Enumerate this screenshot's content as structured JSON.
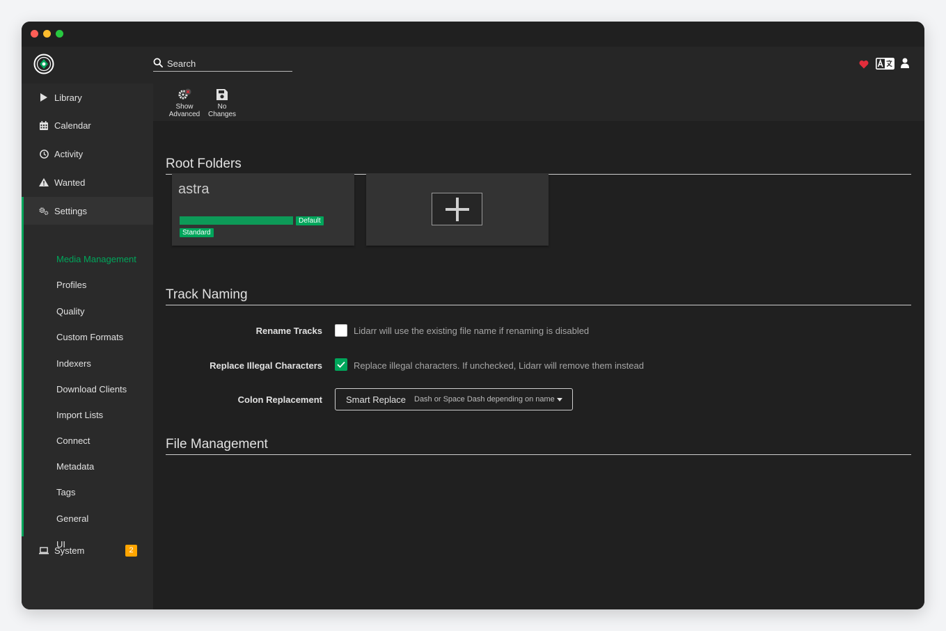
{
  "header": {
    "search_placeholder": "Search"
  },
  "sidebar": {
    "items": [
      {
        "label": "Library",
        "icon": "play-icon"
      },
      {
        "label": "Calendar",
        "icon": "calendar-icon"
      },
      {
        "label": "Activity",
        "icon": "clock-icon"
      },
      {
        "label": "Wanted",
        "icon": "warning-icon"
      },
      {
        "label": "Settings",
        "icon": "cogs-icon"
      }
    ],
    "settings_children": [
      "Media Management",
      "Profiles",
      "Quality",
      "Custom Formats",
      "Indexers",
      "Download Clients",
      "Import Lists",
      "Connect",
      "Metadata",
      "Tags",
      "General",
      "UI"
    ],
    "system": {
      "label": "System",
      "icon": "laptop-icon",
      "badge": "2"
    }
  },
  "toolbar": {
    "show_advanced": [
      "Show",
      "Advanced"
    ],
    "no_changes": [
      "No",
      "Changes"
    ]
  },
  "sections": {
    "root_folders": "Root Folders",
    "track_naming": "Track Naming",
    "file_management": "File Management"
  },
  "root_folder": {
    "name": "astra",
    "tag_default": "Default",
    "tag_standard": "Standard",
    "usage_fraction": 1.0
  },
  "form": {
    "rename_tracks": {
      "label": "Rename Tracks",
      "checked": false,
      "help": "Lidarr will use the existing file name if renaming is disabled"
    },
    "replace_illegal": {
      "label": "Replace Illegal Characters",
      "checked": true,
      "help": "Replace illegal characters. If unchecked, Lidarr will remove them instead"
    },
    "colon_replacement": {
      "label": "Colon Replacement",
      "value": "Smart Replace",
      "hint": "Dash or Space Dash depending on name"
    }
  },
  "colors": {
    "accent": "#00a65b",
    "heart": "#e22d3b",
    "badge": "#ffa500"
  }
}
